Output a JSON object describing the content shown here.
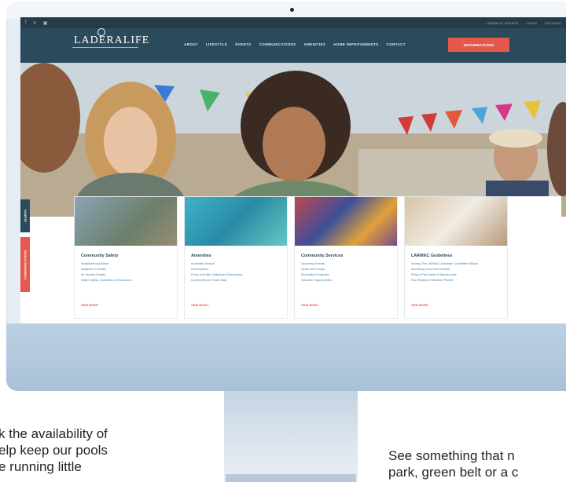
{
  "site": {
    "logo": "LADERALIFE",
    "social": [
      "f",
      "✕",
      "▣"
    ],
    "top_links": [
      "LADERA R. EVENTS",
      "LOGIN",
      "ACCOUNT"
    ],
    "nav": [
      "ABOUT",
      "LIFESTYLE",
      "EVENTS",
      "COMMUNICATIONS",
      "AMENITIES",
      "HOME IMPROVEMENTS",
      "CONTACT"
    ],
    "cta": "INFORMATIONS"
  },
  "side_tabs": [
    "ALERTS",
    "COMMUNICATIONS"
  ],
  "cards": [
    {
      "title": "Community Safety",
      "links": [
        "Neighborhood Watch",
        "Neighbor to Health",
        "All Heralds Emails",
        "Water Safety, Guidelines & Resources"
      ],
      "more": "VIEW MORE ›"
    },
    {
      "title": "Amenities",
      "links": [
        "Amenities Search",
        "Reservations",
        "Pools and Hills Clubhouse Reservation",
        "Community and Trails Map"
      ],
      "more": "VIEW MORE ›"
    },
    {
      "title": "Community Services",
      "links": [
        "Upcoming Events",
        "Clubs and Groups",
        "Recreation Programs",
        "Volunteer Opportunities"
      ],
      "more": "VIEW MORE ›"
    },
    {
      "title": "LARMAC Guidelines",
      "links": [
        "Visiting The LARMAC Available Committee Offices",
        "Accessing Your HOA Number",
        "Filing a Plan Made & Maintenance",
        "New Resident Welcome Packet"
      ],
      "more": "VIEW MORE ›"
    }
  ],
  "captions": {
    "left": [
      "k the availability of",
      "elp keep our pools",
      "e running little"
    ],
    "right": [
      "See something that n",
      "park, green belt or a c"
    ]
  },
  "colors": {
    "navbar": "#2b4b5c",
    "topbar": "#263b4a",
    "accent": "#e5584b",
    "link": "#3f7fb0"
  }
}
